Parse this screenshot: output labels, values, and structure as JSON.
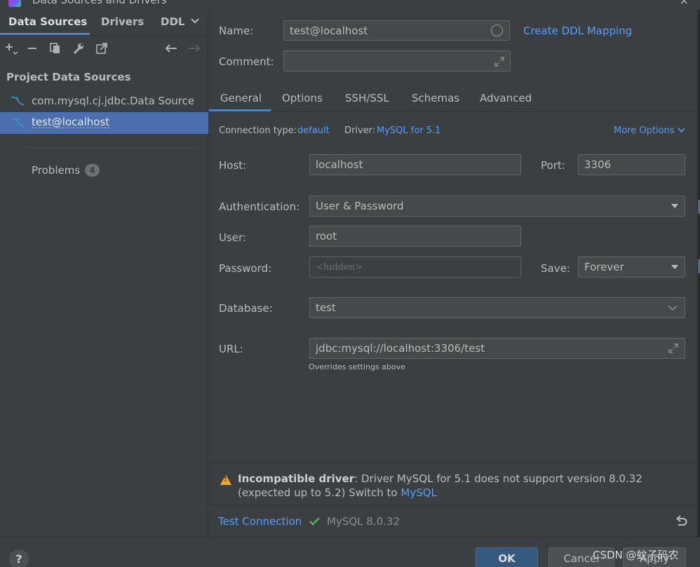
{
  "window": {
    "title": "Data Sources and Drivers",
    "close_glyph": "×"
  },
  "left": {
    "tabs": [
      {
        "label": "Data Sources"
      },
      {
        "label": "Drivers"
      },
      {
        "label": "DDL"
      }
    ],
    "toolbar_icons": [
      "add-icon",
      "remove-icon",
      "duplicate-icon",
      "wrench-icon",
      "jump-to-icon",
      "back-arrow-icon",
      "forward-arrow-icon"
    ],
    "section_title": "Project Data Sources",
    "items": [
      {
        "label": "com.mysql.cj.jdbc.Data Source",
        "icon": "mysql-dolphin-icon"
      },
      {
        "label": "test@localhost",
        "icon": "mysql-dolphin-icon",
        "selected": true
      }
    ],
    "problems_label": "Problems",
    "problems_count": "4"
  },
  "form": {
    "name_label": "Name:",
    "name_value": "test@localhost",
    "create_ddl_link": "Create DDL Mapping",
    "comment_label": "Comment:",
    "comment_value": "",
    "tabs": [
      {
        "label": "General",
        "active": true
      },
      {
        "label": "Options"
      },
      {
        "label": "SSH/SSL"
      },
      {
        "label": "Schemas"
      },
      {
        "label": "Advanced"
      }
    ],
    "connection_type_label": "Connection type:",
    "connection_type_value": "default",
    "driver_label": "Driver:",
    "driver_value": "MySQL for 5.1",
    "more_options": "More Options",
    "host_label": "Host:",
    "host_value": "localhost",
    "port_label": "Port:",
    "port_value": "3306",
    "auth_label": "Authentication:",
    "auth_value": "User & Password",
    "user_label": "User:",
    "user_value": "root",
    "password_label": "Password:",
    "password_placeholder": "<hidden>",
    "save_label": "Save:",
    "save_value": "Forever",
    "database_label": "Database:",
    "database_value": "test",
    "url_label": "URL:",
    "url_value": "jdbc:mysql://localhost:3306/test",
    "url_hint": "Overrides settings above"
  },
  "warning": {
    "title": "Incompatible driver",
    "message": ": Driver MySQL for 5.1 does not support version 8.0.32 (expected up to 5.2) Switch to ",
    "switch_link": "MySQL"
  },
  "test": {
    "link": "Test Connection",
    "result": "MySQL 8.0.32"
  },
  "buttons": {
    "help": "?",
    "ok": "OK",
    "cancel": "Cancel",
    "apply": "Apply"
  },
  "watermark": "CSDN @蚊子码农",
  "colors": {
    "background": "#3c3f41",
    "selection": "#4b6eaf",
    "link": "#589df6",
    "accent": "#4a88c7",
    "warning": "#f0a732",
    "success": "#59a869"
  }
}
